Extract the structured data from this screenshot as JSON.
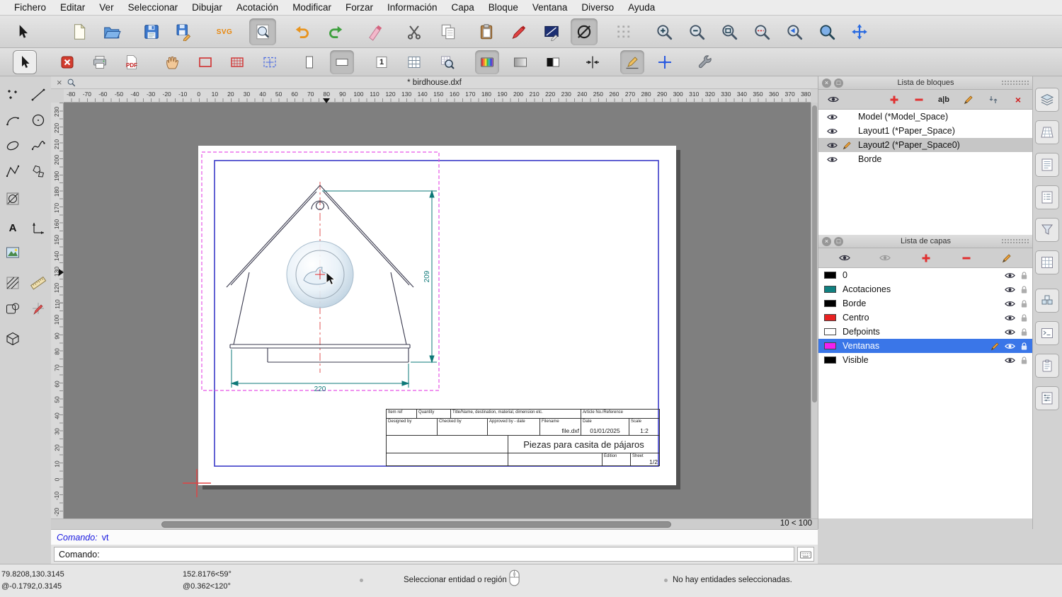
{
  "colors": {
    "selection_highlight": "#3a76e8",
    "dimension_teal": "#0e7878",
    "centerline_red": "#e05555",
    "paper_border_blue": "#3c3cc8",
    "viewport_magenta": "#e655e6",
    "layer_magenta": "#f020f0",
    "layer_teal": "#108080",
    "layer_red": "#e82222"
  },
  "menubar": {
    "items": [
      "Fichero",
      "Editar",
      "Ver",
      "Seleccionar",
      "Dibujar",
      "Acotación",
      "Modificar",
      "Forzar",
      "Información",
      "Capa",
      "Bloque",
      "Ventana",
      "Diverso",
      "Ayuda"
    ]
  },
  "toolbar": {
    "svg_label": "SVG",
    "pdf_label": "PDF",
    "page_number_label": "1"
  },
  "palette": {
    "text_tool_label": "A"
  },
  "document": {
    "tab_title": "* birdhouse.dxf"
  },
  "rulers": {
    "horizontal": [
      "-80",
      "-70",
      "-60",
      "-50",
      "-40",
      "-30",
      "-20",
      "-10",
      "0",
      "10",
      "20",
      "30",
      "40",
      "50",
      "60",
      "70",
      "80",
      "90",
      "100",
      "110",
      "120",
      "130",
      "140",
      "150",
      "160",
      "170",
      "180",
      "190",
      "200",
      "210",
      "220",
      "230",
      "240",
      "250",
      "260",
      "270",
      "280",
      "290",
      "300",
      "310",
      "320",
      "330",
      "340",
      "350",
      "360",
      "370",
      "380"
    ],
    "vertical": [
      "230",
      "220",
      "210",
      "200",
      "190",
      "180",
      "170",
      "160",
      "150",
      "140",
      "130",
      "120",
      "110",
      "100",
      "90",
      "80",
      "70",
      "60",
      "50",
      "40",
      "30",
      "20",
      "10",
      "0",
      "-10",
      "-20"
    ]
  },
  "drawing": {
    "dim_height": "209",
    "dim_width": "220"
  },
  "titleblock": {
    "item_ref": "Item ref",
    "quantity": "Quantity",
    "title_name": "Title/Name, destination, material, dimension etc.",
    "article_no": "Article No./Reference",
    "designed_by": "Designed by",
    "checked_by": "Checked by",
    "approved_by": "Approved by - date",
    "filename_label": "Filename",
    "filename": "file.dxf",
    "date_label": "Date",
    "date": "01/01/2025",
    "scale_label": "Scale",
    "scale": "1:2",
    "title": "Piezas para casita de pájaros",
    "edition_label": "Edition",
    "sheet_label": "Sheet",
    "sheet": "1/2"
  },
  "blocks_panel": {
    "title": "Lista de bloques",
    "rename_label": "a|b",
    "items": [
      {
        "label": "Model (*Model_Space)",
        "selected": false
      },
      {
        "label": "Layout1 (*Paper_Space)",
        "selected": false
      },
      {
        "label": "Layout2 (*Paper_Space0)",
        "selected": true
      },
      {
        "label": "Borde",
        "selected": false
      }
    ]
  },
  "layers_panel": {
    "title": "Lista de capas",
    "items": [
      {
        "name": "0",
        "color": "#000000",
        "selected": false
      },
      {
        "name": "Acotaciones",
        "color": "#108080",
        "selected": false
      },
      {
        "name": "Borde",
        "color": "#000000",
        "selected": false
      },
      {
        "name": "Centro",
        "color": "#e82222",
        "selected": false
      },
      {
        "name": "Defpoints",
        "color": "#ffffff",
        "selected": false
      },
      {
        "name": "Ventanas",
        "color": "#f020f0",
        "selected": true
      },
      {
        "name": "Visible",
        "color": "#000000",
        "selected": false
      }
    ]
  },
  "canvas_footer": {
    "zoom_text": "10 < 100"
  },
  "command": {
    "history_prompt": "Comando:",
    "history_entry": "vt",
    "input_prompt": "Comando:",
    "input_value": ""
  },
  "statusbar": {
    "coord_absolute": "79.8208,130.3145",
    "coord_relative": "@-0.1792,0.3145",
    "polar_absolute": "152.8176<59°",
    "polar_relative": "@0.362<120°",
    "hint": "Seleccionar entidad o región",
    "selection_info": "No hay entidades seleccionadas."
  }
}
